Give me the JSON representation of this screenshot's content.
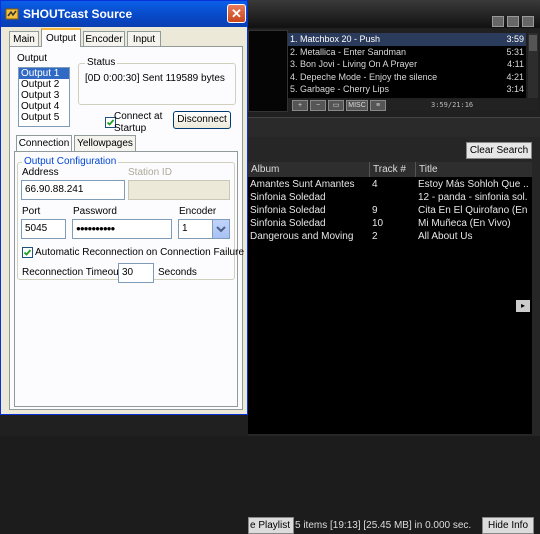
{
  "dialog": {
    "title": "SHOUTcast Source",
    "close_symbol": "✕",
    "tabs": [
      "Main",
      "Output",
      "Encoder",
      "Input"
    ],
    "active_tab": "Output",
    "output_label": "Output",
    "outputs": [
      "Output 1",
      "Output 2",
      "Output 3",
      "Output 4",
      "Output 5"
    ],
    "selected_output": "Output 1",
    "status_label": "Status",
    "status_text": "[0D 0:00:30] Sent 119589 bytes",
    "connect_at_startup_label": "Connect at Startup",
    "connect_at_startup_checked": true,
    "disconnect_label": "Disconnect",
    "subtabs": [
      "Connection",
      "Yellowpages"
    ],
    "active_subtab": "Connection",
    "output_config_label": "Output Configuration",
    "address_label": "Address",
    "address_value": "66.90.88.241",
    "station_id_label": "Station ID",
    "station_id_value": "",
    "port_label": "Port",
    "port_value": "5045",
    "password_label": "Password",
    "password_value": "●●●●●●●●●●",
    "encoder_label": "Encoder",
    "encoder_value": "1",
    "auto_reconnect_label": "Automatic Reconnection on Connection Failure",
    "auto_reconnect_checked": true,
    "reconnect_timeout_label": "Reconnection Timeout",
    "reconnect_timeout_value": "30",
    "seconds_label": "Seconds"
  },
  "winamp": {
    "playlist": [
      {
        "title": "1. Matchbox 20 - Push",
        "duration": "3:59"
      },
      {
        "title": "2. Metallica - Enter Sandman",
        "duration": "5:31"
      },
      {
        "title": "3. Bon Jovi - Living On A Prayer",
        "duration": "4:11"
      },
      {
        "title": "4. Depeche Mode - Enjoy the silence",
        "duration": "4:21"
      },
      {
        "title": "5. Garbage - Cherry Lips",
        "duration": "3:14"
      }
    ],
    "playlist_buttons": [
      "+",
      "−",
      "▭",
      "MISC",
      "≡"
    ],
    "playlist_time": "3:59/21:16",
    "clear_search_label": "Clear Search",
    "columns": [
      "Album",
      "Track #",
      "Title"
    ],
    "rows": [
      {
        "album": "Amantes Sunt Amantes",
        "track": "4",
        "title": "Estoy Más Sohloh Que ..."
      },
      {
        "album": "Sinfonia Soledad",
        "track": "",
        "title": "12 - panda - sinfonia sol..."
      },
      {
        "album": "Sinfonia Soledad",
        "track": "9",
        "title": "Cita En El Quirofano (En ..."
      },
      {
        "album": "Sinfonia Soledad",
        "track": "10",
        "title": "Mi Muñeca (En Vivo)"
      },
      {
        "album": "Dangerous and Moving",
        "track": "2",
        "title": "All About Us"
      }
    ],
    "playlist_button_label": "e Playlist",
    "status_text": "5 items [19:13] [25.45 MB]  in 0.000 sec.",
    "hide_info_label": "Hide Info"
  }
}
